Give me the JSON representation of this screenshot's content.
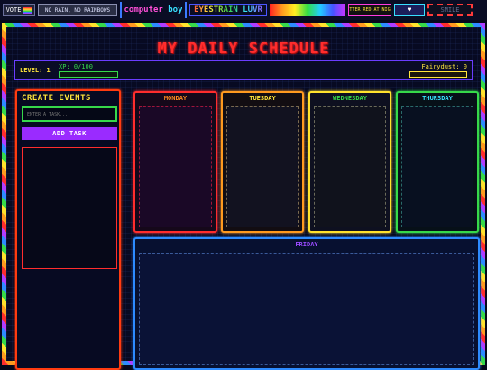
{
  "banner": {
    "badge1": "VOTE",
    "badge2": "NO RAIN, NO RAINBOWS",
    "badge3_a": "computer",
    "badge3_b": "boy",
    "badge4": "EYESTRAIN LUVR",
    "badge6": "BETTER RED AT NIGHT",
    "badge7": "",
    "badge8": "SMILE"
  },
  "header": {
    "title": "MY DAILY SCHEDULE"
  },
  "status": {
    "level_label": "LEVEL: 1",
    "xp_label": "XP: 0/100",
    "xp_progress": 0,
    "fairydust_label": "Fairydust: 0",
    "fairydust_progress": 0
  },
  "create_events": {
    "heading": "CREATE EVENTS",
    "input_placeholder": "ENTER A TASK...",
    "input_value": "",
    "add_button": "ADD TASK"
  },
  "days": {
    "monday": "MONDAY",
    "tuesday": "TUESDAY",
    "wednesday": "WEDNESDAY",
    "thursday": "THURSDAY",
    "friday": "FRIDAY"
  },
  "colors": {
    "accent_red": "#ff2d2d",
    "accent_purple": "#9a2bff",
    "accent_green": "#36d94a",
    "accent_yellow": "#ffe53b",
    "accent_blue": "#2d8bff"
  }
}
